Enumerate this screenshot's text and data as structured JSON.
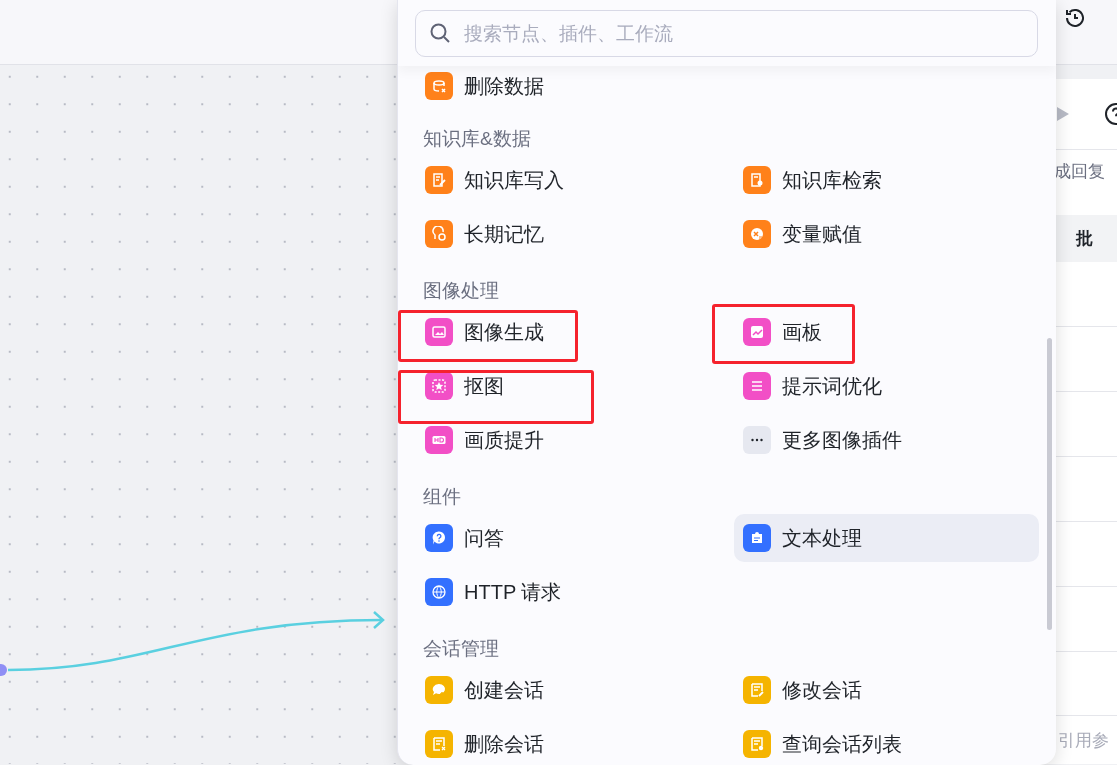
{
  "search": {
    "placeholder": "搜索节点、插件、工作流"
  },
  "sections": [
    {
      "items": [
        {
          "label": "删除数据",
          "kind": "database-delete",
          "color": "#ff811a",
          "hovered": false,
          "highlighted": false
        }
      ]
    },
    {
      "title": "知识库&数据",
      "items": [
        {
          "label": "知识库写入",
          "kind": "document",
          "color": "#ff811a",
          "hovered": false,
          "highlighted": false
        },
        {
          "label": "知识库检索",
          "kind": "search-doc",
          "color": "#ff811a",
          "hovered": false,
          "highlighted": false
        },
        {
          "label": "长期记忆",
          "kind": "memory",
          "color": "#ff811a",
          "hovered": false,
          "highlighted": false
        },
        {
          "label": "变量赋值",
          "kind": "variable",
          "color": "#ff811a",
          "hovered": false,
          "highlighted": false
        }
      ]
    },
    {
      "title": "图像处理",
      "items": [
        {
          "label": "图像生成",
          "kind": "image",
          "color": "#f24fc6",
          "hovered": false,
          "highlighted": true
        },
        {
          "label": "画板",
          "kind": "board",
          "color": "#f24fc6",
          "hovered": false,
          "highlighted": true
        },
        {
          "label": "抠图",
          "kind": "cutout",
          "color": "#f24fc6",
          "hovered": false,
          "highlighted": true
        },
        {
          "label": "提示词优化",
          "kind": "prompt",
          "color": "#f24fc6",
          "hovered": false,
          "highlighted": false
        },
        {
          "label": "画质提升",
          "kind": "hd",
          "color": "#f24fc6",
          "hovered": false,
          "highlighted": false
        },
        {
          "label": "更多图像插件",
          "kind": "more",
          "color": "#e6e8f0",
          "hovered": false,
          "highlighted": false
        }
      ]
    },
    {
      "title": "组件",
      "items": [
        {
          "label": "问答",
          "kind": "question",
          "color": "#3370ff",
          "hovered": false,
          "highlighted": false
        },
        {
          "label": "文本处理",
          "kind": "plugin",
          "color": "#3370ff",
          "hovered": true,
          "highlighted": false
        },
        {
          "label": "HTTP 请求",
          "kind": "http",
          "color": "#3370ff",
          "hovered": false,
          "highlighted": false
        }
      ]
    },
    {
      "title": "会话管理",
      "items": [
        {
          "label": "创建会话",
          "kind": "chat-add",
          "color": "#f5b400",
          "hovered": false,
          "highlighted": false
        },
        {
          "label": "修改会话",
          "kind": "edit",
          "color": "#f5b400",
          "hovered": false,
          "highlighted": false
        },
        {
          "label": "删除会话",
          "kind": "chat-delete",
          "color": "#f5b400",
          "hovered": false,
          "highlighted": false
        },
        {
          "label": "查询会话列表",
          "kind": "chat-list",
          "color": "#f5b400",
          "hovered": false,
          "highlighted": false
        }
      ]
    }
  ],
  "side_panel": {
    "reply_label": "成回复",
    "table_header": "批",
    "input_placeholder": "引用参"
  }
}
